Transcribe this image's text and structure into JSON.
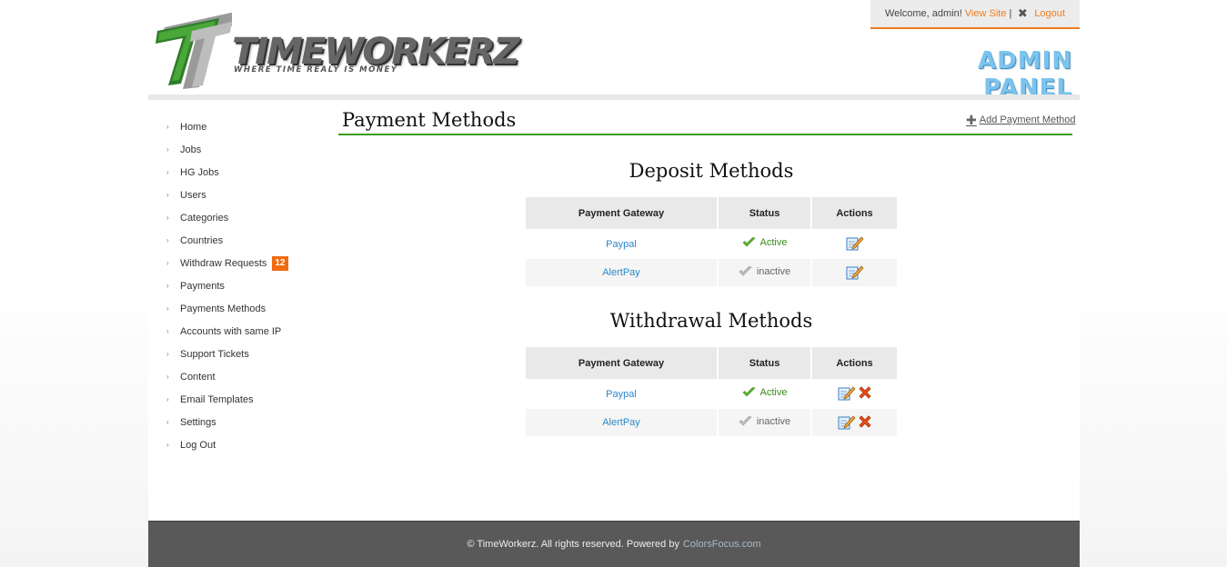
{
  "header": {
    "logo_main": "TIMEWORKERZ",
    "logo_tagline": "WHERE TIME REALY IS MONEY",
    "welcome_text": "Welcome, admin!",
    "view_site_label": "View Site",
    "separator": "|",
    "logout_label": "Logout",
    "panel_title": "ADMIN PANEL"
  },
  "sidebar": {
    "items": [
      {
        "label": "Home"
      },
      {
        "label": "Jobs"
      },
      {
        "label": "HG Jobs"
      },
      {
        "label": "Users"
      },
      {
        "label": "Categories"
      },
      {
        "label": "Countries"
      },
      {
        "label": "Withdraw Requests",
        "badge": "12"
      },
      {
        "label": "Payments"
      },
      {
        "label": "Payments Methods"
      },
      {
        "label": "Accounts with same IP"
      },
      {
        "label": "Support Tickets"
      },
      {
        "label": "Content"
      },
      {
        "label": "Email Templates"
      },
      {
        "label": "Settings"
      },
      {
        "label": "Log Out"
      }
    ]
  },
  "main": {
    "title": "Payment Methods",
    "add_label": "Add Payment Method",
    "columns": [
      "Payment Gateway",
      "Status",
      "Actions"
    ],
    "deposit": {
      "title": "Deposit Methods",
      "rows": [
        {
          "gateway": "Paypal",
          "status": "Active"
        },
        {
          "gateway": "AlertPay",
          "status": "inactive"
        }
      ]
    },
    "withdrawal": {
      "title": "Withdrawal Methods",
      "rows": [
        {
          "gateway": "Paypal",
          "status": "Active"
        },
        {
          "gateway": "AlertPay",
          "status": "inactive"
        }
      ]
    }
  },
  "footer": {
    "text": "© TimeWorkerz. All rights reserved. Powered by",
    "powered_link": "ColorsFocus.com"
  },
  "colors": {
    "accent_orange": "#f07b1e",
    "accent_green": "#3a9a1e",
    "link_blue": "#2a87c8",
    "admin_panel_blue": "#7cc4ee"
  },
  "icons": {
    "edit": "edit-icon",
    "delete": "delete-icon",
    "active": "check-icon",
    "inactive": "check-grey-icon",
    "add": "plus-icon",
    "logout": "close-icon"
  }
}
